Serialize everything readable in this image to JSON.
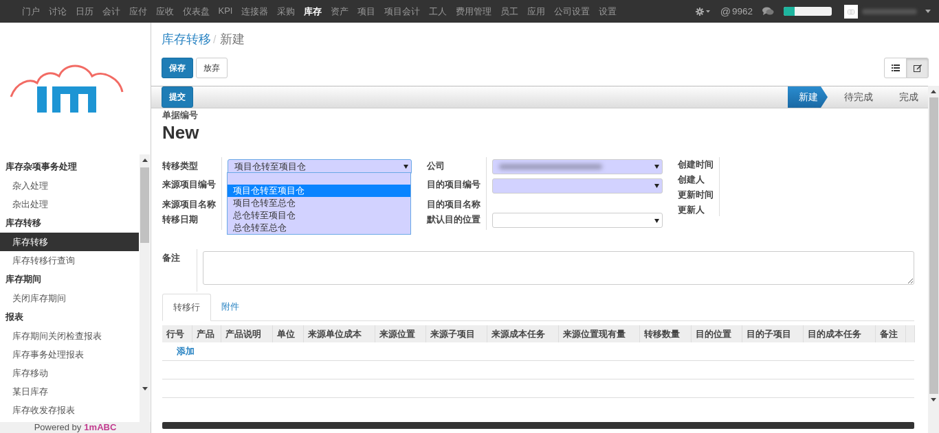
{
  "top_menu": [
    {
      "label": "门户",
      "selected": false
    },
    {
      "label": "讨论",
      "selected": false
    },
    {
      "label": "日历",
      "selected": false
    },
    {
      "label": "会计",
      "selected": false
    },
    {
      "label": "应付",
      "selected": false
    },
    {
      "label": "应收",
      "selected": false
    },
    {
      "label": "仪表盘",
      "selected": false
    },
    {
      "label": "KPI",
      "selected": false
    },
    {
      "label": "连接器",
      "selected": false
    },
    {
      "label": "采购",
      "selected": false
    },
    {
      "label": "库存",
      "selected": true
    },
    {
      "label": "资产",
      "selected": false
    },
    {
      "label": "项目",
      "selected": false
    },
    {
      "label": "项目会计",
      "selected": false
    },
    {
      "label": "工人",
      "selected": false
    },
    {
      "label": "费用管理",
      "selected": false
    },
    {
      "label": "员工",
      "selected": false
    },
    {
      "label": "应用",
      "selected": false
    },
    {
      "label": "公司设置",
      "selected": false
    },
    {
      "label": "设置",
      "selected": false
    }
  ],
  "top_right": {
    "mention": "@",
    "count": "9962",
    "quota": {
      "level": 0.23
    }
  },
  "sidebar": {
    "sections": [
      {
        "title": "库存杂项事务处理",
        "items": [
          {
            "label": "杂入处理",
            "selected": false
          },
          {
            "label": "杂出处理",
            "selected": false
          }
        ]
      },
      {
        "title": "库存转移",
        "items": [
          {
            "label": "库存转移",
            "selected": true
          },
          {
            "label": "库存转移行查询",
            "selected": false
          }
        ]
      },
      {
        "title": "库存期间",
        "items": [
          {
            "label": "关闭库存期间",
            "selected": false
          }
        ]
      },
      {
        "title": "报表",
        "items": [
          {
            "label": "库存期间关闭检查报表",
            "selected": false
          },
          {
            "label": "库存事务处理报表",
            "selected": false
          },
          {
            "label": "库存移动",
            "selected": false
          },
          {
            "label": "某日库存",
            "selected": false
          },
          {
            "label": "库存收发存报表",
            "selected": false
          }
        ]
      }
    ],
    "footer": {
      "prefix": "Powered by",
      "brand": "1mABC"
    }
  },
  "breadcrumb": {
    "parent": "库存转移",
    "separator": "/",
    "current": "新建"
  },
  "buttons": [
    {
      "label": "保存",
      "kind": "primary"
    },
    {
      "label": "放弃",
      "kind": "default"
    }
  ],
  "view_switch": [
    {
      "kind": "list",
      "selected": false
    },
    {
      "kind": "form",
      "selected": true
    }
  ],
  "submit_button": "提交",
  "stages": [
    {
      "label": "新建",
      "selected": true
    },
    {
      "label": "待完成",
      "selected": false
    },
    {
      "label": "完成",
      "selected": false
    }
  ],
  "doc_number_label": "单据编号",
  "doc_number": "New",
  "form": {
    "left": [
      {
        "label": "转移类型",
        "value": "项目仓转至项目仓",
        "kind": "select",
        "required": true
      },
      {
        "label": "来源项目编号",
        "kind": "none"
      },
      {
        "label": "来源项目名称",
        "kind": "none"
      },
      {
        "label": "转移日期",
        "kind": "none"
      }
    ],
    "dropdown": {
      "has_blank_option": true,
      "options": [
        {
          "label": "项目仓转至项目仓",
          "selected": true
        },
        {
          "label": "项目仓转至总仓",
          "selected": false
        },
        {
          "label": "总仓转至项目仓",
          "selected": false
        },
        {
          "label": "总仓转至总仓",
          "selected": false
        }
      ]
    },
    "middle": [
      {
        "label": "公司",
        "kind": "blurred",
        "required": true
      },
      {
        "label": "目的项目编号",
        "kind": "select",
        "required": true
      },
      {
        "label": "目的项目名称",
        "kind": "none"
      },
      {
        "label": "默认目的位置",
        "kind": "select",
        "required": false
      }
    ],
    "right": [
      {
        "label": "创建时间"
      },
      {
        "label": "创建人"
      },
      {
        "label": "更新时间"
      },
      {
        "label": "更新人"
      }
    ],
    "notes_label": "备注"
  },
  "tabs": [
    {
      "label": "转移行",
      "selected": true
    },
    {
      "label": "附件",
      "selected": false
    }
  ],
  "table": {
    "columns": [
      "行号",
      "产品",
      "产品说明",
      "单位",
      "来源单位成本",
      "来源位置",
      "来源子项目",
      "来源成本任务",
      "来源位置现有量",
      "转移数量",
      "目的位置",
      "目的子项目",
      "目的成本任务",
      "备注"
    ],
    "add_link": "添加"
  }
}
